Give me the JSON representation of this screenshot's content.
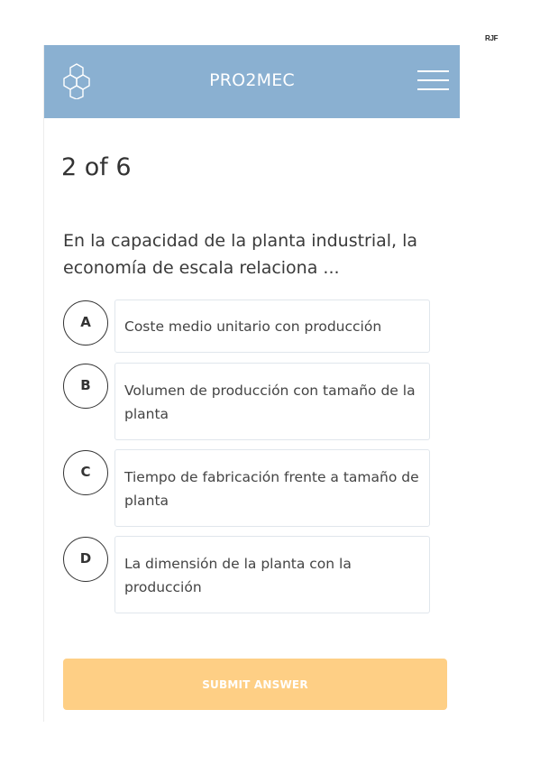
{
  "corner_tag": "RJF",
  "header": {
    "title": "PRO2MEC",
    "logo_icon": "hexagon-molecule-icon",
    "menu_icon": "hamburger-menu-icon",
    "background_color": "#8ab0d1"
  },
  "quiz": {
    "progress": "2 of 6",
    "question": "En la capacidad de la planta industrial, la economía de escala relaciona ...",
    "options": [
      {
        "letter": "A",
        "text": "Coste medio unitario con producción"
      },
      {
        "letter": "B",
        "text": "Volumen de producción con tamaño de la planta"
      },
      {
        "letter": "C",
        "text": "Tiempo de fabricación frente a tamaño de planta"
      },
      {
        "letter": "D",
        "text": "La dimensión de la planta con la producción"
      }
    ],
    "submit_label": "SUBMIT ANSWER",
    "submit_color": "#fecf85"
  }
}
